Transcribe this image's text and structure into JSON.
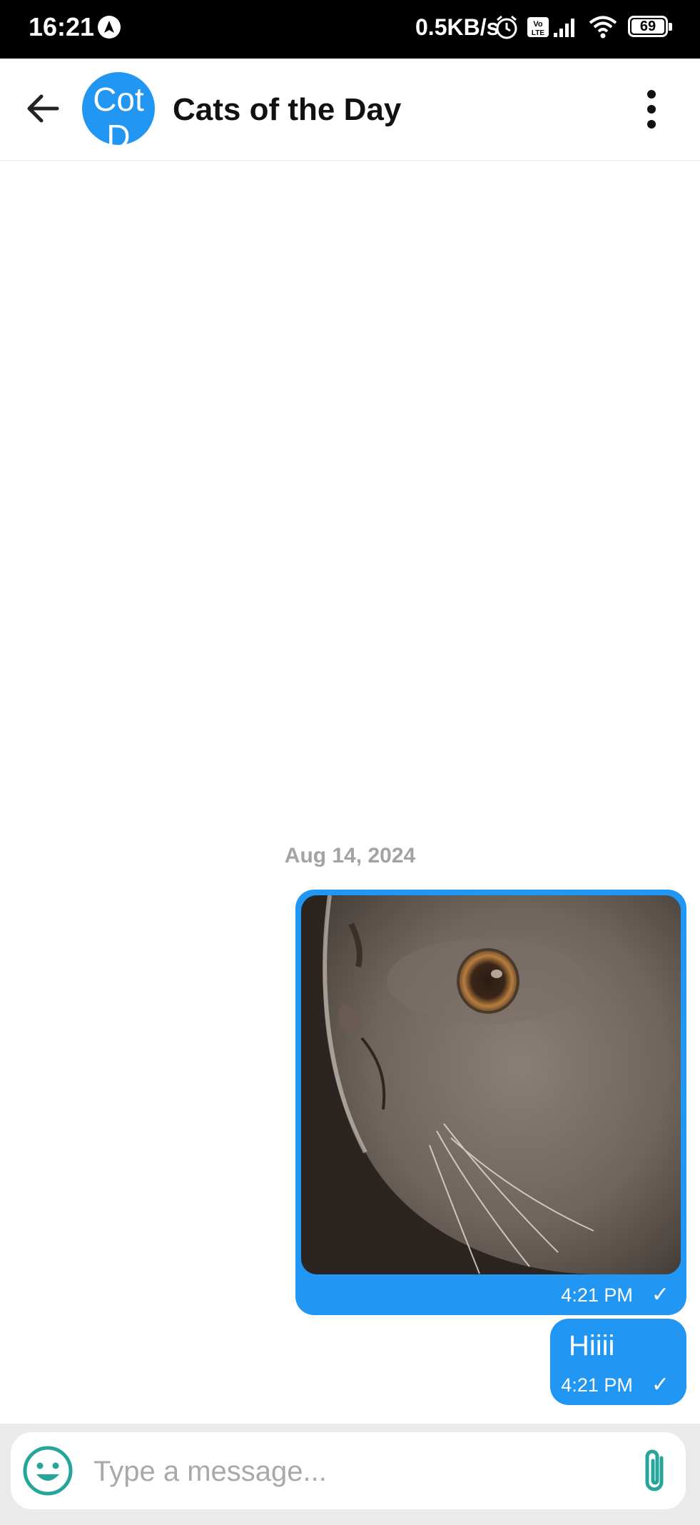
{
  "status_bar": {
    "time": "16:21",
    "network_speed": "0.5KB/s",
    "volte_label": "Vo LTE",
    "battery": "69",
    "icons": [
      "navigation-icon",
      "alarm-icon",
      "volte-icon",
      "signal-icon",
      "wifi-icon",
      "battery-icon"
    ]
  },
  "header": {
    "avatar_text": "CotD",
    "title": "Cats of the Day",
    "icons": [
      "back-arrow-icon",
      "more-vertical-icon"
    ]
  },
  "messages": {
    "date_separator": "Aug 14, 2024",
    "items": [
      {
        "type": "image",
        "image": "cat-photo",
        "time": "4:21 PM",
        "status": "✓"
      },
      {
        "type": "text",
        "text": "Hiiii",
        "time": "4:21 PM",
        "status": "✓"
      }
    ]
  },
  "composer": {
    "placeholder": "Type a message...",
    "value": "",
    "icons": [
      "emoji-icon",
      "paperclip-icon"
    ]
  },
  "colors": {
    "accent": "#2196f3",
    "emoji_icon": "#26a69a",
    "attach_icon": "#26a69a"
  }
}
